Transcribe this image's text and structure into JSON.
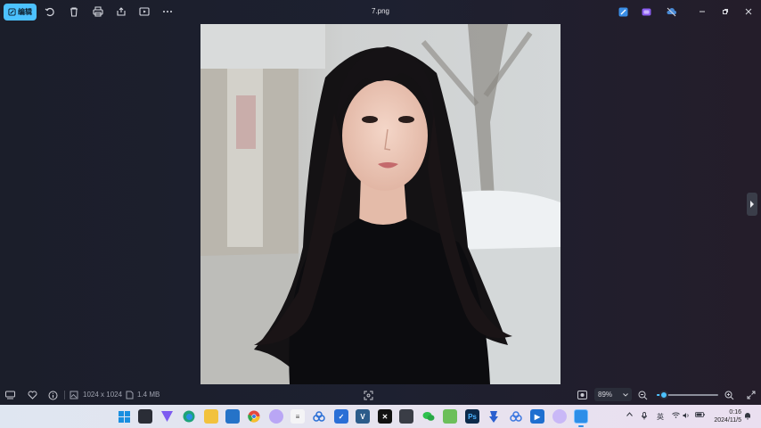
{
  "window": {
    "title": "7.png",
    "edit_label": "编辑"
  },
  "toolbar": {
    "icons": [
      "edit-icon",
      "rotate-icon",
      "delete-icon",
      "print-icon",
      "share-icon",
      "slideshow-icon",
      "more-icon"
    ]
  },
  "status": {
    "dimensions": "1024 x 1024",
    "filesize": "1.4 MB",
    "zoom": "89%",
    "zoom_fraction": 0.12
  },
  "taskbar": {
    "ime": "英",
    "time": "0:16",
    "date": "2024/11/5"
  },
  "colors": {
    "accent": "#4cc2ff",
    "background": "#1c1f2b"
  }
}
